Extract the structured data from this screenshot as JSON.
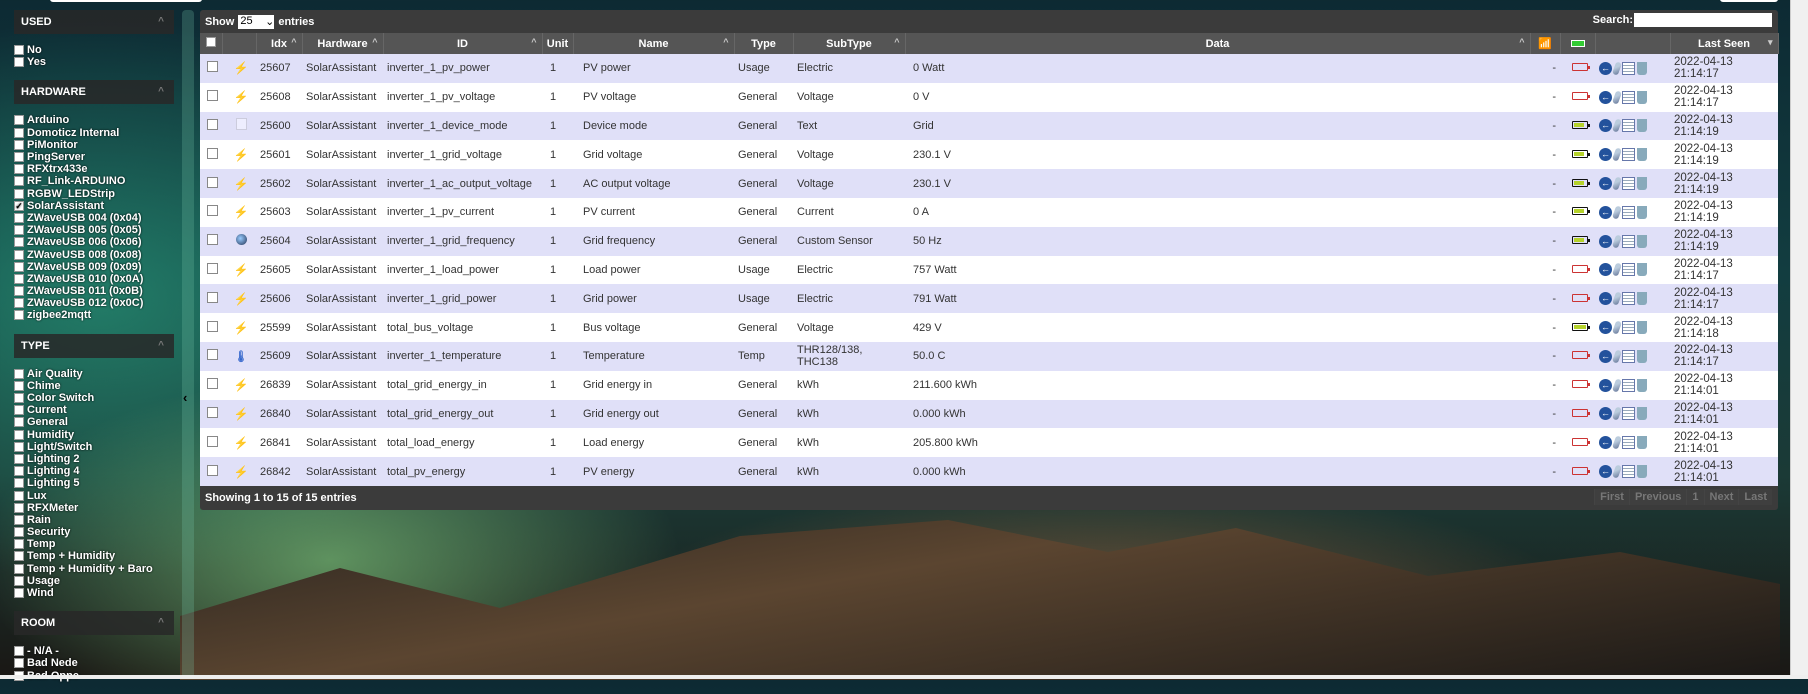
{
  "sidebar": {
    "used": {
      "title": "USED",
      "items": [
        {
          "label": "No",
          "checked": false
        },
        {
          "label": "Yes",
          "checked": false
        }
      ]
    },
    "hardware": {
      "title": "HARDWARE",
      "items": [
        {
          "label": "Arduino",
          "checked": false
        },
        {
          "label": "Domoticz Internal",
          "checked": false
        },
        {
          "label": "PiMonitor",
          "checked": false
        },
        {
          "label": "PingServer",
          "checked": false
        },
        {
          "label": "RFXtrx433e",
          "checked": false
        },
        {
          "label": "RF_Link-ARDUINO",
          "checked": false
        },
        {
          "label": "RGBW_LEDStrip",
          "checked": false
        },
        {
          "label": "SolarAssistant",
          "checked": true
        },
        {
          "label": "ZWaveUSB 004 (0x04)",
          "checked": false
        },
        {
          "label": "ZWaveUSB 005 (0x05)",
          "checked": false
        },
        {
          "label": "ZWaveUSB 006 (0x06)",
          "checked": false
        },
        {
          "label": "ZWaveUSB 008 (0x08)",
          "checked": false
        },
        {
          "label": "ZWaveUSB 009 (0x09)",
          "checked": false
        },
        {
          "label": "ZWaveUSB 010 (0x0A)",
          "checked": false
        },
        {
          "label": "ZWaveUSB 011 (0x0B)",
          "checked": false
        },
        {
          "label": "ZWaveUSB 012 (0x0C)",
          "checked": false
        },
        {
          "label": "zigbee2mqtt",
          "checked": false
        }
      ]
    },
    "type": {
      "title": "TYPE",
      "items": [
        {
          "label": "Air Quality"
        },
        {
          "label": "Chime"
        },
        {
          "label": "Color Switch"
        },
        {
          "label": "Current"
        },
        {
          "label": "General"
        },
        {
          "label": "Humidity"
        },
        {
          "label": "Light/Switch"
        },
        {
          "label": "Lighting 2"
        },
        {
          "label": "Lighting 4"
        },
        {
          "label": "Lighting 5"
        },
        {
          "label": "Lux"
        },
        {
          "label": "RFXMeter"
        },
        {
          "label": "Rain"
        },
        {
          "label": "Security"
        },
        {
          "label": "Temp"
        },
        {
          "label": "Temp + Humidity"
        },
        {
          "label": "Temp + Humidity + Baro"
        },
        {
          "label": "Usage"
        },
        {
          "label": "Wind"
        }
      ]
    },
    "room": {
      "title": "ROOM",
      "items": [
        {
          "label": "- N/A -"
        },
        {
          "label": "Bad Nede"
        },
        {
          "label": "Bad Oppe"
        }
      ]
    }
  },
  "toolbar": {
    "show": "Show",
    "entries_value": "25",
    "entries": "entries",
    "search_label": "Search:",
    "search_value": ""
  },
  "columns": {
    "idx": "Idx",
    "hardware": "Hardware",
    "id": "ID",
    "unit": "Unit",
    "name": "Name",
    "type": "Type",
    "subtype": "SubType",
    "data": "Data",
    "last_seen": "Last Seen"
  },
  "rows": [
    {
      "icon": "lightning",
      "idx": "25607",
      "hardware": "SolarAssistant",
      "id": "inverter_1_pv_power",
      "unit": "1",
      "name": "PV power",
      "type": "Usage",
      "subtype": "Electric",
      "data": "0 Watt",
      "signal": "-",
      "battery": "empty",
      "date": "2022-04-13",
      "time": "21:14:17"
    },
    {
      "icon": "lightning",
      "idx": "25608",
      "hardware": "SolarAssistant",
      "id": "inverter_1_pv_voltage",
      "unit": "1",
      "name": "PV voltage",
      "type": "General",
      "subtype": "Voltage",
      "data": "0 V",
      "signal": "-",
      "battery": "empty",
      "date": "2022-04-13",
      "time": "21:14:17"
    },
    {
      "icon": "text",
      "idx": "25600",
      "hardware": "SolarAssistant",
      "id": "inverter_1_device_mode",
      "unit": "1",
      "name": "Device mode",
      "type": "General",
      "subtype": "Text",
      "data": "Grid",
      "signal": "-",
      "battery": "ok",
      "date": "2022-04-13",
      "time": "21:14:19"
    },
    {
      "icon": "lightning",
      "idx": "25601",
      "hardware": "SolarAssistant",
      "id": "inverter_1_grid_voltage",
      "unit": "1",
      "name": "Grid voltage",
      "type": "General",
      "subtype": "Voltage",
      "data": "230.1 V",
      "signal": "-",
      "battery": "ok",
      "date": "2022-04-13",
      "time": "21:14:19"
    },
    {
      "icon": "lightning",
      "idx": "25602",
      "hardware": "SolarAssistant",
      "id": "inverter_1_ac_output_voltage",
      "unit": "1",
      "name": "AC output voltage",
      "type": "General",
      "subtype": "Voltage",
      "data": "230.1 V",
      "signal": "-",
      "battery": "ok",
      "date": "2022-04-13",
      "time": "21:14:19"
    },
    {
      "icon": "lightning",
      "idx": "25603",
      "hardware": "SolarAssistant",
      "id": "inverter_1_pv_current",
      "unit": "1",
      "name": "PV current",
      "type": "General",
      "subtype": "Current",
      "data": "0 A",
      "signal": "-",
      "battery": "ok",
      "date": "2022-04-13",
      "time": "21:14:19"
    },
    {
      "icon": "globe",
      "idx": "25604",
      "hardware": "SolarAssistant",
      "id": "inverter_1_grid_frequency",
      "unit": "1",
      "name": "Grid frequency",
      "type": "General",
      "subtype": "Custom Sensor",
      "data": "50 Hz",
      "signal": "-",
      "battery": "ok",
      "date": "2022-04-13",
      "time": "21:14:19"
    },
    {
      "icon": "lightning",
      "idx": "25605",
      "hardware": "SolarAssistant",
      "id": "inverter_1_load_power",
      "unit": "1",
      "name": "Load power",
      "type": "Usage",
      "subtype": "Electric",
      "data": "757 Watt",
      "signal": "-",
      "battery": "empty",
      "date": "2022-04-13",
      "time": "21:14:17"
    },
    {
      "icon": "lightning",
      "idx": "25606",
      "hardware": "SolarAssistant",
      "id": "inverter_1_grid_power",
      "unit": "1",
      "name": "Grid power",
      "type": "Usage",
      "subtype": "Electric",
      "data": "791 Watt",
      "signal": "-",
      "battery": "empty",
      "date": "2022-04-13",
      "time": "21:14:17"
    },
    {
      "icon": "lightning",
      "idx": "25599",
      "hardware": "SolarAssistant",
      "id": "total_bus_voltage",
      "unit": "1",
      "name": "Bus voltage",
      "type": "General",
      "subtype": "Voltage",
      "data": "429 V",
      "signal": "-",
      "battery": "full",
      "date": "2022-04-13",
      "time": "21:14:18"
    },
    {
      "icon": "thermometer",
      "idx": "25609",
      "hardware": "SolarAssistant",
      "id": "inverter_1_temperature",
      "unit": "1",
      "name": "Temperature",
      "type": "Temp",
      "subtype": "THR128/138, THC138",
      "data": "50.0 C",
      "signal": "-",
      "battery": "empty",
      "date": "2022-04-13",
      "time": "21:14:17"
    },
    {
      "icon": "lightning",
      "idx": "26839",
      "hardware": "SolarAssistant",
      "id": "total_grid_energy_in",
      "unit": "1",
      "name": "Grid energy in",
      "type": "General",
      "subtype": "kWh",
      "data": "211.600 kWh",
      "signal": "-",
      "battery": "empty",
      "date": "2022-04-13",
      "time": "21:14:01"
    },
    {
      "icon": "lightning",
      "idx": "26840",
      "hardware": "SolarAssistant",
      "id": "total_grid_energy_out",
      "unit": "1",
      "name": "Grid energy out",
      "type": "General",
      "subtype": "kWh",
      "data": "0.000 kWh",
      "signal": "-",
      "battery": "empty",
      "date": "2022-04-13",
      "time": "21:14:01"
    },
    {
      "icon": "lightning",
      "idx": "26841",
      "hardware": "SolarAssistant",
      "id": "total_load_energy",
      "unit": "1",
      "name": "Load energy",
      "type": "General",
      "subtype": "kWh",
      "data": "205.800 kWh",
      "signal": "-",
      "battery": "empty",
      "date": "2022-04-13",
      "time": "21:14:01"
    },
    {
      "icon": "lightning",
      "idx": "26842",
      "hardware": "SolarAssistant",
      "id": "total_pv_energy",
      "unit": "1",
      "name": "PV energy",
      "type": "General",
      "subtype": "kWh",
      "data": "0.000 kWh",
      "signal": "-",
      "battery": "empty",
      "date": "2022-04-13",
      "time": "21:14:01"
    }
  ],
  "footer": {
    "info": "Showing 1 to 15 of 15 entries",
    "first": "First",
    "previous": "Previous",
    "page": "1",
    "next": "Next",
    "last": "Last"
  },
  "colors": {
    "row_odd": "#e0e0f8",
    "row_even": "#ffffff",
    "header": "#555555",
    "battery_low": "#cc3333",
    "battery_ok": "#b5d22a"
  }
}
